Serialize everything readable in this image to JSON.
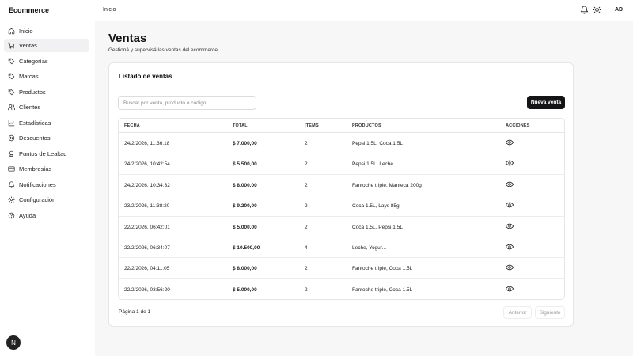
{
  "app": {
    "brand": "Ecommerce",
    "breadcrumb": "Inicio",
    "avatar": "AD",
    "logo_letter": "N"
  },
  "icons": {
    "bell": "bell-icon",
    "theme": "sun-icon"
  },
  "sidebar": {
    "items": [
      {
        "label": "Inicio",
        "icon": "home-icon"
      },
      {
        "label": "Ventas",
        "icon": "cart-icon",
        "active": true
      },
      {
        "label": "Categorías",
        "icon": "tag-icon"
      },
      {
        "label": "Marcas",
        "icon": "tag-icon"
      },
      {
        "label": "Productos",
        "icon": "tag-icon"
      },
      {
        "label": "Clientes",
        "icon": "users-icon"
      },
      {
        "label": "Estadísticas",
        "icon": "chart-icon"
      },
      {
        "label": "Descuentos",
        "icon": "percent-icon"
      },
      {
        "label": "Puntos de Lealtad",
        "icon": "award-icon"
      },
      {
        "label": "Membresías",
        "icon": "card-icon"
      },
      {
        "label": "Notificaciones",
        "icon": "bell-icon"
      },
      {
        "label": "Configuración",
        "icon": "gear-icon"
      },
      {
        "label": "Ayuda",
        "icon": "help-icon"
      }
    ]
  },
  "page": {
    "title": "Ventas",
    "subtitle": "Gestioná y supervisá las ventas del ecommerce."
  },
  "card": {
    "title": "Listado de ventas",
    "search_placeholder": "Buscar por venta, producto o código...",
    "new_button": "Nueva venta"
  },
  "table": {
    "headers": [
      "FECHA",
      "TOTAL",
      "ITEMS",
      "PRODUCTOS",
      "ACCIONES"
    ],
    "rows": [
      {
        "fecha": "24/2/2026, 11:36:18",
        "total": "$ 7.000,00",
        "items": "2",
        "productos": "Pepsi 1.5L, Coca 1.5L"
      },
      {
        "fecha": "24/2/2026, 10:42:54",
        "total": "$ 5.500,00",
        "items": "2",
        "productos": "Pepsi 1.5L, Leche"
      },
      {
        "fecha": "24/2/2026, 10:34:32",
        "total": "$ 8.000,00",
        "items": "2",
        "productos": "Fantoche triple, Manteca 200g"
      },
      {
        "fecha": "23/2/2026, 11:38:20",
        "total": "$ 9.200,00",
        "items": "2",
        "productos": "Coca 1.5L, Lays 85g"
      },
      {
        "fecha": "22/2/2026, 06:42:01",
        "total": "$ 5.000,00",
        "items": "2",
        "productos": "Coca 1.5L, Pepsi 1.5L"
      },
      {
        "fecha": "22/2/2026, 06:34:07",
        "total": "$ 10.500,00",
        "items": "4",
        "productos": "Leche, Yogur..."
      },
      {
        "fecha": "22/2/2026, 04:11:05",
        "total": "$ 8.000,00",
        "items": "2",
        "productos": "Fantoche triple, Coca 1.5L"
      },
      {
        "fecha": "22/2/2026, 03:56:20",
        "total": "$ 5.000,00",
        "items": "2",
        "productos": "Fantoche triple, Coca 1.5L"
      }
    ],
    "row_action_icon": "eye-icon"
  },
  "pagination": {
    "label": "Página 1 de 1",
    "prev": "Anterior",
    "next": "Siguiente"
  }
}
